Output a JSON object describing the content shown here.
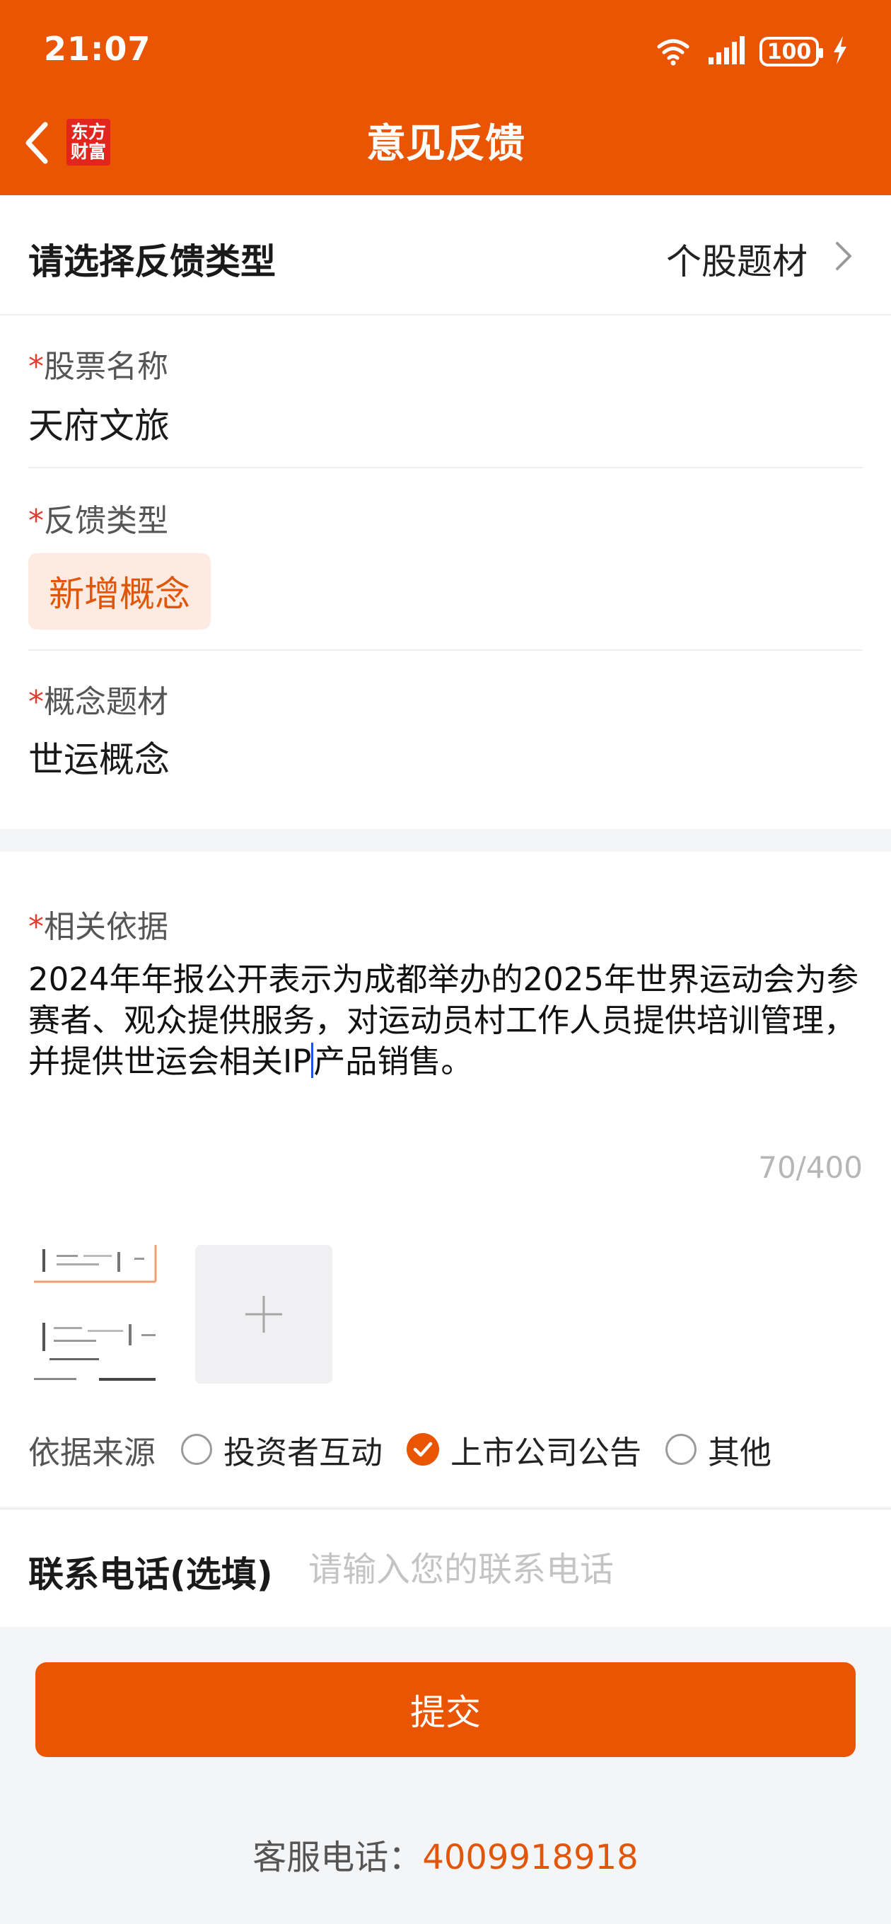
{
  "status_bar": {
    "time": "21:07",
    "battery": "100"
  },
  "nav": {
    "title": "意见反馈",
    "logo_line1": "东方",
    "logo_line2": "财富"
  },
  "feedback_type": {
    "label": "请选择反馈类型",
    "value": "个股题材"
  },
  "form": {
    "stock_name_label": "股票名称",
    "stock_name_value": "天府文旅",
    "feedback_category_label": "反馈类型",
    "feedback_category_chip": "新增概念",
    "concept_label": "概念题材",
    "concept_value": "世运概念",
    "required_mark": "*"
  },
  "basis": {
    "label": "相关依据",
    "text_before_cursor": "2024年年报公开表示为成都举办的2025年世界运动会为参赛者、观众提供服务，对运动员村工作人员提供培训管理，并提供世运会相关IP",
    "text_after_cursor": "产品销售。",
    "counter": "70/400"
  },
  "source": {
    "label": "依据来源",
    "options": [
      {
        "label": "投资者互动",
        "checked": false
      },
      {
        "label": "上市公司公告",
        "checked": true
      },
      {
        "label": "其他",
        "checked": false
      }
    ]
  },
  "phone": {
    "label": "联系电话(选填)",
    "placeholder": "请输入您的联系电话",
    "value": ""
  },
  "submit_label": "提交",
  "service": {
    "label": "客服电话：",
    "number": "4009918918"
  },
  "colors": {
    "brand": "#ea5504",
    "chip_bg": "#fdebe2",
    "required": "#e23b2e"
  }
}
